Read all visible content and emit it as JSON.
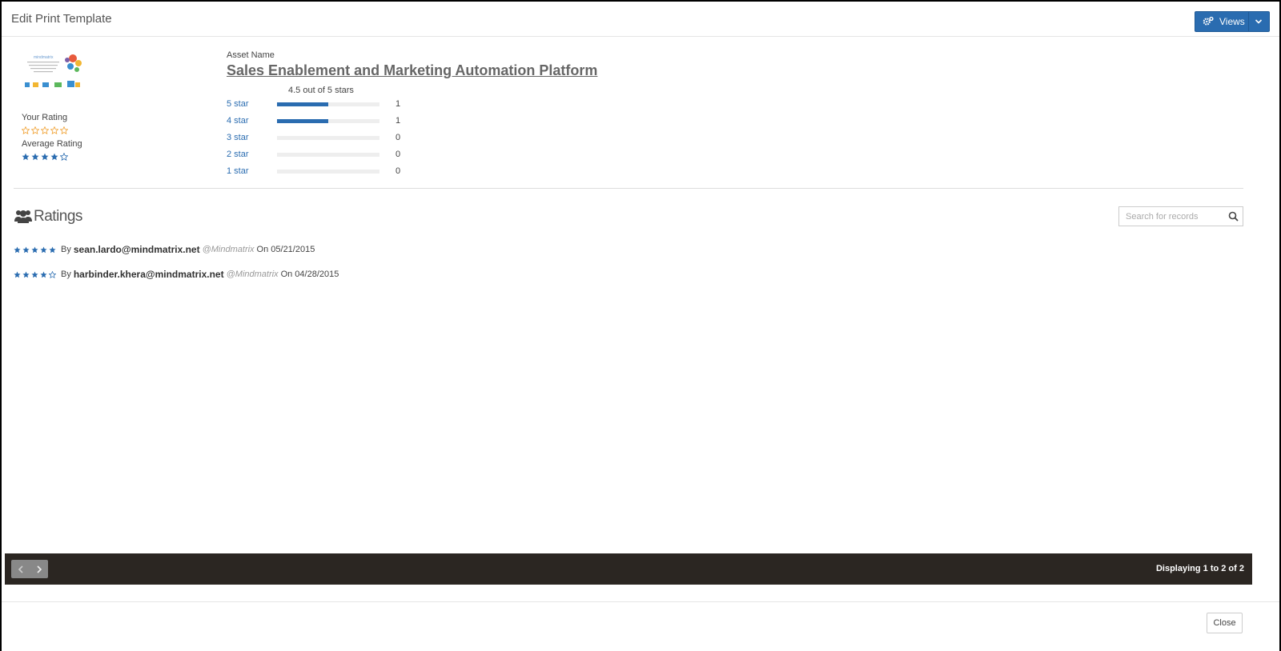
{
  "header": {
    "title": "Edit Print Template",
    "views_label": "Views"
  },
  "asset": {
    "name_label": "Asset Name",
    "name": "Sales Enablement and Marketing Automation Platform",
    "summary": "4.5 out of 5 stars"
  },
  "sidebar": {
    "your_rating_label": "Your Rating",
    "your_rating_value": 0,
    "average_rating_label": "Average Rating",
    "average_rating_value": 4
  },
  "histogram": [
    {
      "label": "5 star",
      "count": "1",
      "fraction": 0.5
    },
    {
      "label": "4 star",
      "count": "1",
      "fraction": 0.5
    },
    {
      "label": "3 star",
      "count": "0",
      "fraction": 0
    },
    {
      "label": "2 star",
      "count": "0",
      "fraction": 0
    },
    {
      "label": "1 star",
      "count": "0",
      "fraction": 0
    }
  ],
  "ratings_section": {
    "title": "Ratings",
    "search_placeholder": "Search for records"
  },
  "reviews": [
    {
      "stars": 5,
      "by": "By",
      "email": "sean.lardo@mindmatrix.net",
      "org": "@Mindmatrix",
      "date": "On 05/21/2015"
    },
    {
      "stars": 4,
      "by": "By",
      "email": "harbinder.khera@mindmatrix.net",
      "org": "@Mindmatrix",
      "date": "On 04/28/2015"
    }
  ],
  "footer": {
    "displaying": "Displaying 1 to 2 of 2",
    "close_label": "Close"
  },
  "colors": {
    "accent": "#2a6cb0",
    "empty_star": "#f0a030",
    "footer_bar": "#2b2622"
  },
  "icons": {
    "views": "gears-icon",
    "ratings": "users-icon",
    "search": "search-icon",
    "prev": "chevron-left-icon",
    "next": "chevron-right-icon"
  }
}
